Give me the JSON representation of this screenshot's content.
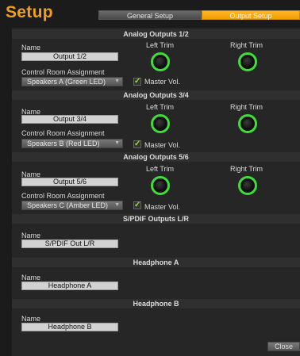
{
  "header": {
    "title": "Setup"
  },
  "tabs": {
    "general": "General Setup",
    "output": "Output Setup"
  },
  "sections": [
    {
      "title": "Analog Outputs 1/2",
      "name_label": "Name",
      "name_value": "Output 1/2",
      "left_trim": "Left Trim",
      "right_trim": "Right Trim",
      "assign_label": "Control Room Assignment",
      "assign_value": "Speakers A (Green LED)",
      "master_vol": "Master Vol."
    },
    {
      "title": "Analog Outputs 3/4",
      "name_label": "Name",
      "name_value": "Output 3/4",
      "left_trim": "Left Trim",
      "right_trim": "Right Trim",
      "assign_label": "Control Room Assignment",
      "assign_value": "Speakers B (Red LED)",
      "master_vol": "Master Vol."
    },
    {
      "title": "Analog Outputs 5/6",
      "name_label": "Name",
      "name_value": "Output 5/6",
      "left_trim": "Left Trim",
      "right_trim": "Right Trim",
      "assign_label": "Control Room Assignment",
      "assign_value": "Speakers C (Amber LED)",
      "master_vol": "Master Vol."
    },
    {
      "title": "S/PDIF Outputs L/R",
      "name_label": "Name",
      "name_value": "S/PDIF Out L/R"
    },
    {
      "title": "Headphone A",
      "name_label": "Name",
      "name_value": "Headphone A"
    },
    {
      "title": "Headphone B",
      "name_label": "Name",
      "name_value": "Headphone B"
    }
  ],
  "buttons": {
    "close": "Close"
  },
  "colors": {
    "accent": "#f0a018",
    "knob_ring": "#3fdc3a",
    "check": "#9be23b"
  }
}
